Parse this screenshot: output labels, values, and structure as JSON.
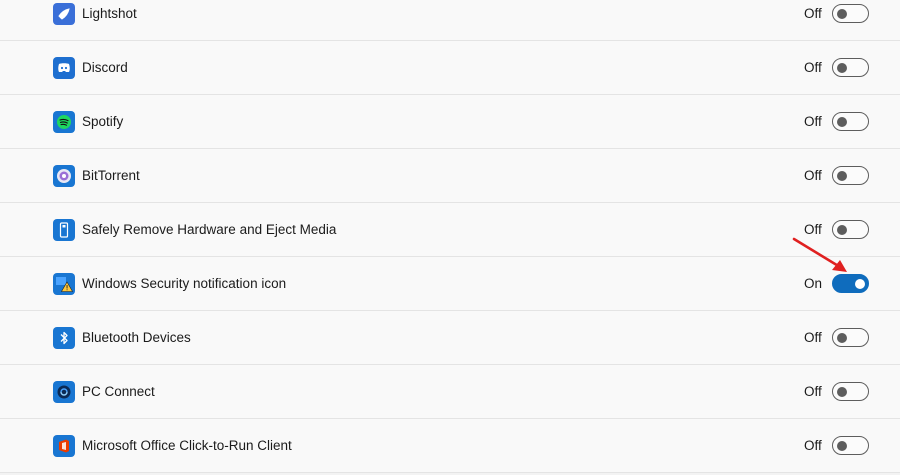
{
  "items": [
    {
      "label": "Lightshot",
      "state": "Off",
      "on": false,
      "icon": "lightshot-icon",
      "icon_color": "#3a6fd8"
    },
    {
      "label": "Discord",
      "state": "Off",
      "on": false,
      "icon": "discord-icon",
      "icon_color": "#1e6fd0"
    },
    {
      "label": "Spotify",
      "state": "Off",
      "on": false,
      "icon": "spotify-icon",
      "icon_color": "#1976d2"
    },
    {
      "label": "BitTorrent",
      "state": "Off",
      "on": false,
      "icon": "bittorrent-icon",
      "icon_color": "#1976d2"
    },
    {
      "label": "Safely Remove Hardware and Eject Media",
      "state": "Off",
      "on": false,
      "icon": "usb-drive-icon",
      "icon_color": "#1976d2"
    },
    {
      "label": "Windows Security notification icon",
      "state": "On",
      "on": true,
      "icon": "windows-security-icon",
      "icon_color": "#1976d2"
    },
    {
      "label": "Bluetooth Devices",
      "state": "Off",
      "on": false,
      "icon": "bluetooth-icon",
      "icon_color": "#1976d2"
    },
    {
      "label": "PC Connect",
      "state": "Off",
      "on": false,
      "icon": "pc-connect-icon",
      "icon_color": "#1976d2"
    },
    {
      "label": "Microsoft Office Click-to-Run Client",
      "state": "Off",
      "on": false,
      "icon": "office-icon",
      "icon_color": "#1976d2"
    }
  ],
  "colors": {
    "accent": "#0f6cbd",
    "annotation_arrow": "#e02020"
  }
}
